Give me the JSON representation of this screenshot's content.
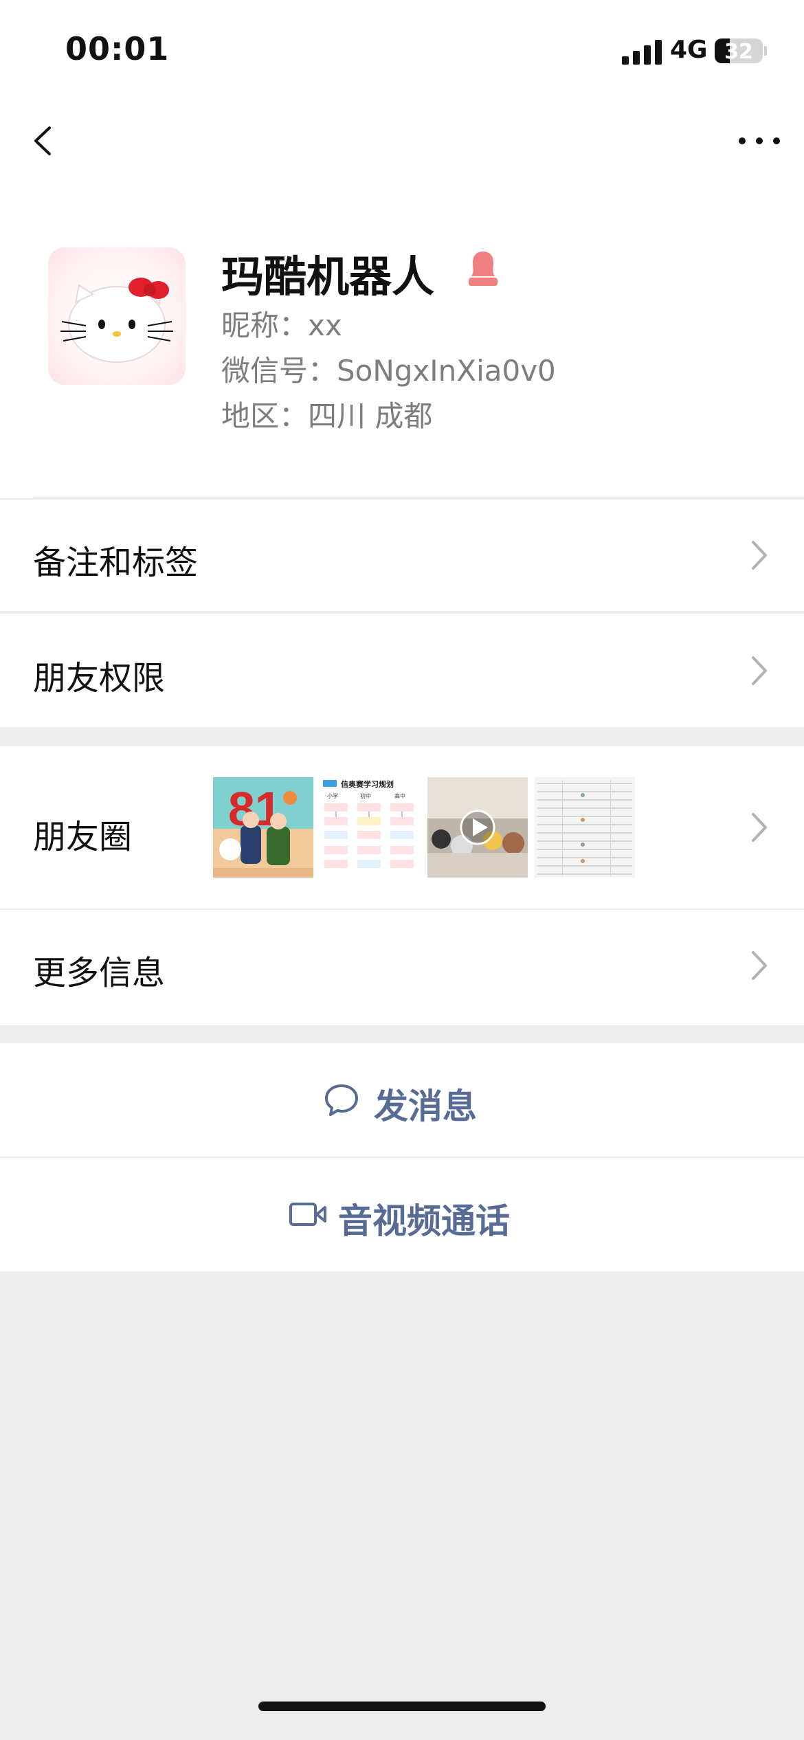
{
  "status_bar": {
    "time": "00:01",
    "network": "4G",
    "battery": "32"
  },
  "nav": {
    "back_icon": "chevron-left-icon",
    "more_icon": "ellipsis-icon"
  },
  "profile": {
    "name": "玛酷机器人",
    "nickname": "昵称：xx",
    "wechat_id": "微信号：SoNgxInXia0v0",
    "region": "地区：四川 成都",
    "gender_icon": "female-icon"
  },
  "rows": {
    "remarks_tags": "备注和标签",
    "friend_permissions": "朋友权限",
    "moments": "朋友圈",
    "more_info": "更多信息"
  },
  "moments_thumbs": {
    "t1_text": "81",
    "t2_title": "信奥赛学习规划",
    "t2_col1": "小学",
    "t2_col2": "初中",
    "t2_col3": "高中"
  },
  "actions": {
    "send_message": "发消息",
    "av_call": "音视频通话"
  },
  "colors": {
    "link_blue": "#576b95",
    "gender_pink": "#f08080"
  }
}
